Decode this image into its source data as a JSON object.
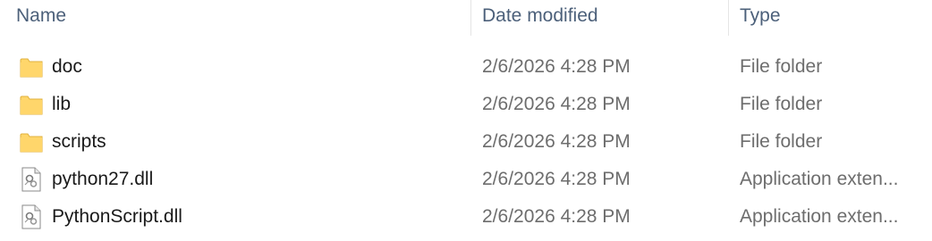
{
  "columns": {
    "name": "Name",
    "date_modified": "Date modified",
    "type": "Type"
  },
  "files": [
    {
      "name": "doc",
      "date_modified": "2/6/2026 4:28 PM",
      "type": "File folder",
      "icon": "folder-icon"
    },
    {
      "name": "lib",
      "date_modified": "2/6/2026 4:28 PM",
      "type": "File folder",
      "icon": "folder-icon"
    },
    {
      "name": "scripts",
      "date_modified": "2/6/2026 4:28 PM",
      "type": "File folder",
      "icon": "folder-icon"
    },
    {
      "name": "python27.dll",
      "date_modified": "2/6/2026 4:28 PM",
      "type": "Application exten...",
      "icon": "dll-file-icon"
    },
    {
      "name": "PythonScript.dll",
      "date_modified": "2/6/2026 4:28 PM",
      "type": "Application exten...",
      "icon": "dll-file-icon"
    }
  ],
  "colors": {
    "header_text": "#4c607a",
    "name_text": "#1a1a1a",
    "detail_text": "#6d6d6d",
    "folder_fill": "#ffd66b",
    "folder_edge": "#e0b13c"
  }
}
